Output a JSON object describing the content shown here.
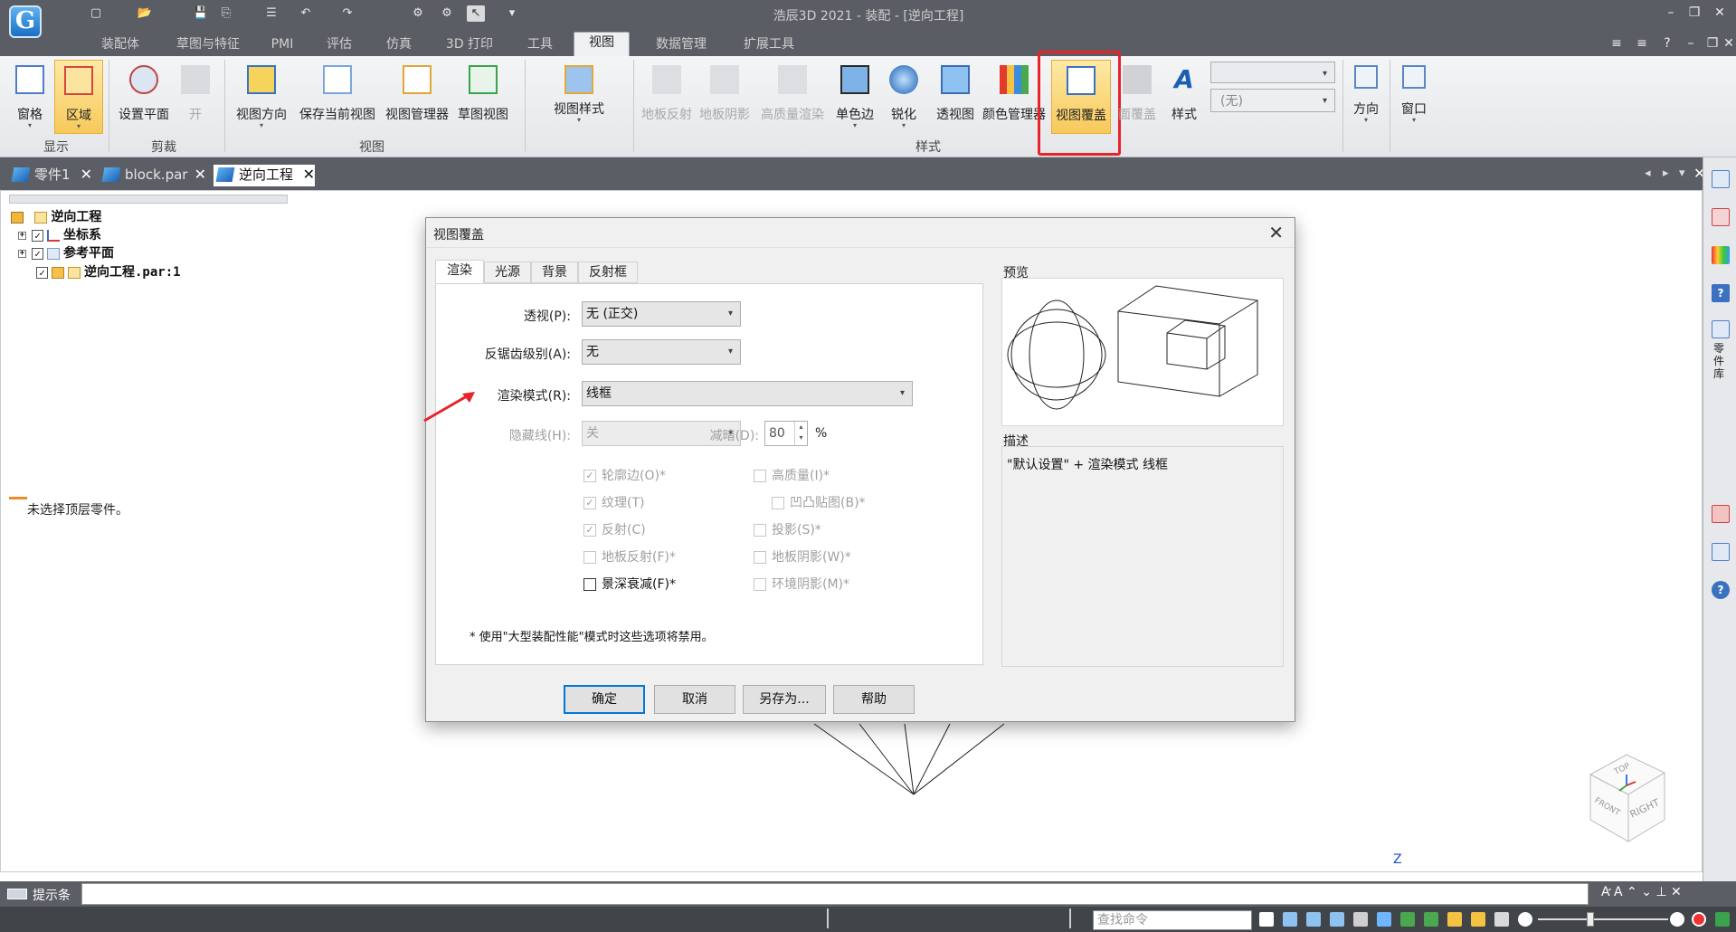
{
  "app": {
    "title": "浩辰3D 2021 - 装配 - [逆向工程]",
    "logo_letter": "G"
  },
  "ribbon_tabs": [
    "装配体",
    "草图与特征",
    "PMI",
    "评估",
    "仿真",
    "3D 打印",
    "工具",
    "视图",
    "数据管理",
    "扩展工具"
  ],
  "active_ribbon_tab": "视图",
  "ribbon": {
    "pane": "窗格",
    "region": "区域",
    "group_display": "显示",
    "set_plane": "设置平面",
    "open": "开",
    "group_crop": "剪裁",
    "view_direction": "视图方向",
    "save_current_view": "保存当前视图",
    "view_manager": "视图管理器",
    "sketch_view": "草图视图",
    "group_view": "视图",
    "view_style": "视图样式",
    "floor_reflection": "地板反射",
    "floor_shadow": "地板阴影",
    "hq_render": "高质量渲染",
    "mono_edge": "单色边",
    "sharpen": "锐化",
    "perspective": "透视图",
    "color_manager": "颜色管理器",
    "view_override": "视图覆盖",
    "face_override": "面覆盖",
    "style": "样式",
    "group_style": "样式",
    "style_combo_value": "(无)",
    "direction": "方向",
    "window": "窗口"
  },
  "doc_tabs": [
    "零件1",
    "block.par",
    "逆向工程"
  ],
  "active_doc_tab": "逆向工程",
  "tree": [
    {
      "label": "逆向工程"
    },
    {
      "label": "坐标系"
    },
    {
      "label": "参考平面"
    },
    {
      "label": "逆向工程.par:1"
    }
  ],
  "no_selection": "未选择顶层零件。",
  "dialog": {
    "title": "视图覆盖",
    "tabs": [
      "渲染",
      "光源",
      "背景",
      "反射框"
    ],
    "active_tab": "渲染",
    "perspective_label": "透视(P):",
    "perspective_value": "无 (正交)",
    "antialias_label": "反锯齿级别(A):",
    "antialias_value": "无",
    "render_mode_label": "渲染模式(R):",
    "render_mode_value": "线框",
    "hidden_line_label": "隐藏线(H):",
    "hidden_line_value": "关",
    "dim_label": "减暗(D):",
    "dim_value": "80",
    "dim_unit": "%",
    "checkboxes_left": [
      {
        "label": "轮廓边(O)*",
        "checked": true,
        "enabled": false
      },
      {
        "label": "纹理(T)",
        "checked": true,
        "enabled": false
      },
      {
        "label": "反射(C)",
        "checked": true,
        "enabled": false
      },
      {
        "label": "地板反射(F)*",
        "checked": false,
        "enabled": false
      },
      {
        "label": "景深衰减(F)*",
        "checked": false,
        "enabled": true
      }
    ],
    "checkboxes_right": [
      {
        "label": "高质量(I)*",
        "checked": false,
        "enabled": false
      },
      {
        "label": "凹凸贴图(B)*",
        "checked": false,
        "enabled": false
      },
      {
        "label": "投影(S)*",
        "checked": false,
        "enabled": false
      },
      {
        "label": "地板阴影(W)*",
        "checked": false,
        "enabled": false
      },
      {
        "label": "环境阴影(M)*",
        "checked": false,
        "enabled": false
      }
    ],
    "footnote": "* 使用\"大型装配性能\"模式时这些选项将禁用。",
    "preview_label": "预览",
    "description_label": "描述",
    "description_text": "\"默认设置\" + 渲染模式 线框",
    "buttons": {
      "ok": "确定",
      "cancel": "取消",
      "save_as": "另存为...",
      "help": "帮助"
    }
  },
  "statusbar": {
    "prompt_label": "提示条",
    "find_command_placeholder": "查找命令"
  },
  "view_cube": {
    "top": "TOP",
    "front": "FRONT",
    "right": "RIGHT"
  },
  "axis_z": "Z",
  "colors": {
    "highlight": "#f8c95a",
    "annotation_red": "#e8232a",
    "accent_blue": "#0078d7",
    "dark_bar": "#5a5d63"
  }
}
